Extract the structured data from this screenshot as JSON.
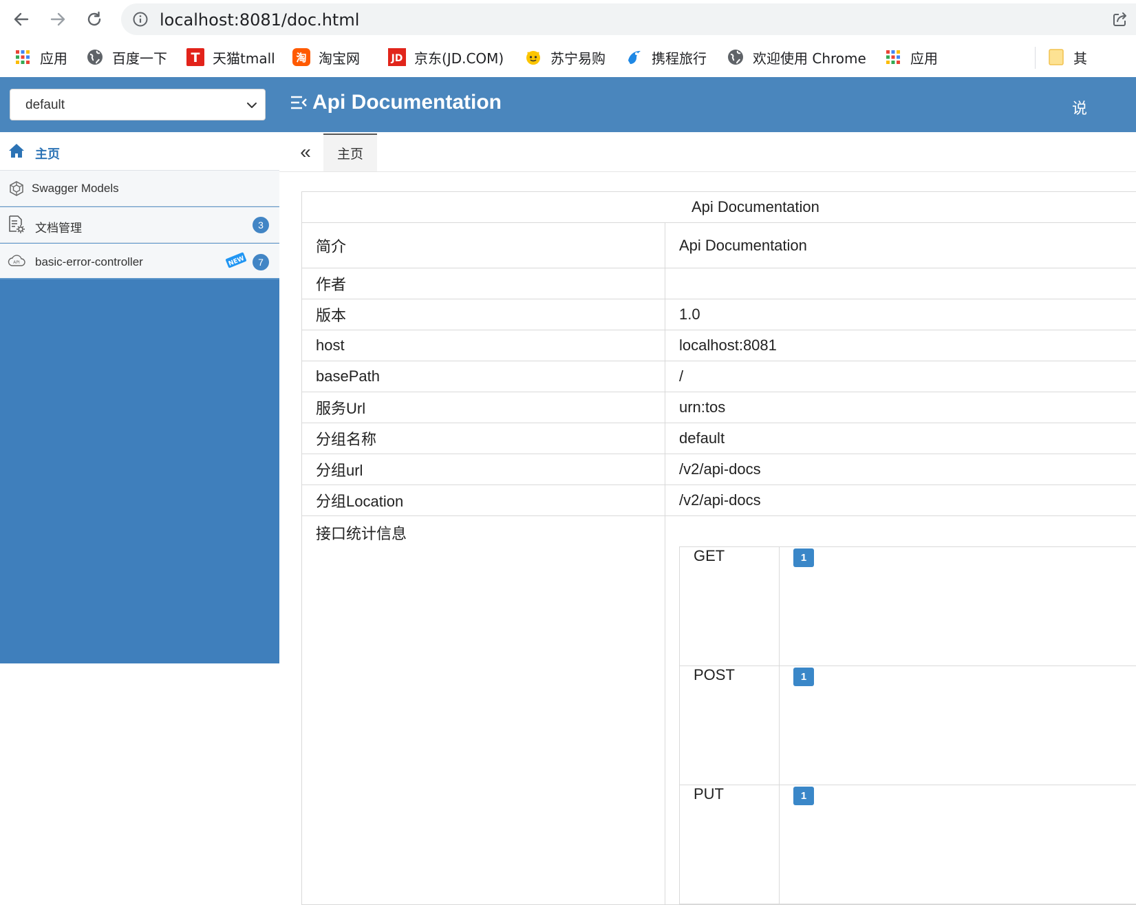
{
  "browser": {
    "url": "localhost:8081/doc.html"
  },
  "bookmarks": [
    {
      "label": "应用",
      "icon": "apps-grid-icon"
    },
    {
      "label": "百度一下",
      "icon": "globe-icon"
    },
    {
      "label": "天猫tmall",
      "icon": "tmall-icon"
    },
    {
      "label": "淘宝网",
      "icon": "taobao-icon"
    },
    {
      "label": "京东(JD.COM)",
      "icon": "jd-icon"
    },
    {
      "label": "苏宁易购",
      "icon": "suning-icon"
    },
    {
      "label": "携程旅行",
      "icon": "ctrip-icon"
    },
    {
      "label": "欢迎使用 Chrome",
      "icon": "globe-icon"
    },
    {
      "label": "应用",
      "icon": "apps-grid-icon"
    },
    {
      "label": "其",
      "icon": "folder-icon"
    }
  ],
  "header": {
    "group_selected": "default",
    "title": "Api Documentation",
    "cut_text": "说"
  },
  "sidebar": {
    "items": [
      {
        "label": "主页",
        "icon": "home-icon"
      },
      {
        "label": "Swagger Models",
        "icon": "models-icon"
      },
      {
        "label": "文档管理",
        "icon": "doc-settings-icon",
        "badge": "3"
      },
      {
        "label": "basic-error-controller",
        "icon": "cloud-api-icon",
        "badge": "7",
        "new_label": "NEW"
      }
    ]
  },
  "tabs": {
    "collapse_symbol": "«",
    "home": "主页"
  },
  "info": {
    "title": "Api Documentation",
    "rows": [
      {
        "key": "简介",
        "value": "Api Documentation"
      },
      {
        "key": "作者",
        "value": ""
      },
      {
        "key": "版本",
        "value": "1.0"
      },
      {
        "key": "host",
        "value": "localhost:8081"
      },
      {
        "key": "basePath",
        "value": "/"
      },
      {
        "key": "服务Url",
        "value": "urn:tos"
      },
      {
        "key": "分组名称",
        "value": "default"
      },
      {
        "key": "分组url",
        "value": "/v2/api-docs"
      },
      {
        "key": "分组Location",
        "value": "/v2/api-docs"
      }
    ],
    "stats_label": "接口统计信息",
    "stats": [
      {
        "method": "GET",
        "count": "1"
      },
      {
        "method": "POST",
        "count": "1"
      },
      {
        "method": "PUT",
        "count": "1"
      }
    ]
  },
  "colors": {
    "header_bg": "#4a86bd",
    "sidebar_bg": "#3f7fbc",
    "accent": "#2c73b5",
    "badge": "#3a87c8"
  }
}
